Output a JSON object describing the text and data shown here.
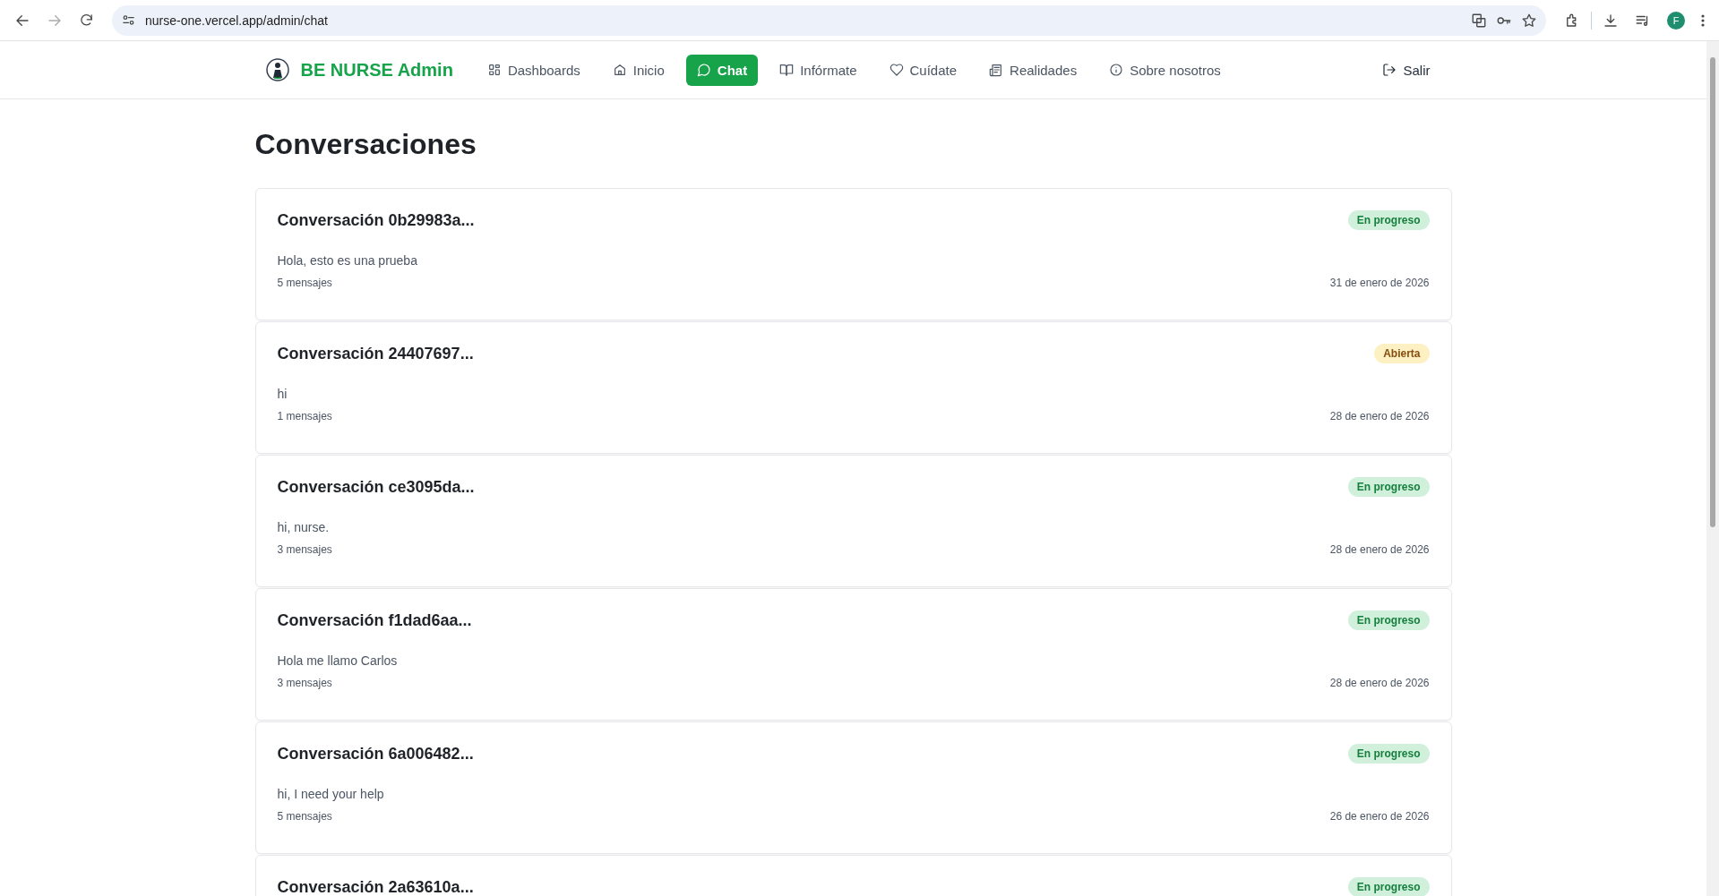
{
  "browser": {
    "url": "nurse-one.vercel.app/admin/chat",
    "profile": "F"
  },
  "nav": {
    "brand": "BE NURSE Admin",
    "items": [
      {
        "label": "Dashboards",
        "selected": false
      },
      {
        "label": "Inicio",
        "selected": false
      },
      {
        "label": "Chat",
        "selected": true
      },
      {
        "label": "Infórmate",
        "selected": false
      },
      {
        "label": "Cuídate",
        "selected": false
      },
      {
        "label": "Realidades",
        "selected": false
      },
      {
        "label": "Sobre nosotros",
        "selected": false
      }
    ],
    "logout": "Salir"
  },
  "heading": "Conversaciones",
  "conversations": [
    {
      "title": "Conversación 0b29983a...",
      "status": {
        "label": "En progreso",
        "kind": "in_progress"
      },
      "preview": "Hola, esto es una prueba",
      "count": "5 mensajes",
      "date": "31 de enero de 2026"
    },
    {
      "title": "Conversación 24407697...",
      "status": {
        "label": "Abierta",
        "kind": "open"
      },
      "preview": "hi",
      "count": "1 mensajes",
      "date": "28 de enero de 2026"
    },
    {
      "title": "Conversación ce3095da...",
      "status": {
        "label": "En progreso",
        "kind": "in_progress"
      },
      "preview": "hi, nurse.",
      "count": "3 mensajes",
      "date": "28 de enero de 2026"
    },
    {
      "title": "Conversación f1dad6aa...",
      "status": {
        "label": "En progreso",
        "kind": "in_progress"
      },
      "preview": "Hola me llamo Carlos",
      "count": "3 mensajes",
      "date": "28 de enero de 2026"
    },
    {
      "title": "Conversación 6a006482...",
      "status": {
        "label": "En progreso",
        "kind": "in_progress"
      },
      "preview": "hi, I need your help",
      "count": "5 mensajes",
      "date": "26 de enero de 2026"
    },
    {
      "title": "Conversación 2a63610a...",
      "status": {
        "label": "En progreso",
        "kind": "in_progress"
      }
    }
  ]
}
